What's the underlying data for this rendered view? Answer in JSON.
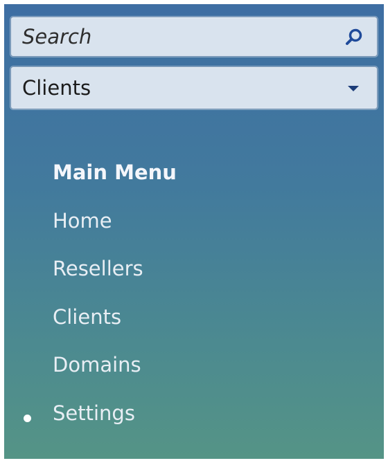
{
  "search": {
    "placeholder": "Search"
  },
  "filter_select": {
    "value": "Clients"
  },
  "menu": {
    "title": "Main Menu",
    "items": [
      {
        "label": "Home"
      },
      {
        "label": "Resellers"
      },
      {
        "label": "Clients"
      },
      {
        "label": "Domains"
      },
      {
        "label": "Settings",
        "active": true
      }
    ]
  },
  "colors": {
    "panel_top": "#3e6ea3",
    "panel_bottom": "#559486",
    "field_bg": "#d9e3ee",
    "icon_blue": "#1c3c78"
  }
}
